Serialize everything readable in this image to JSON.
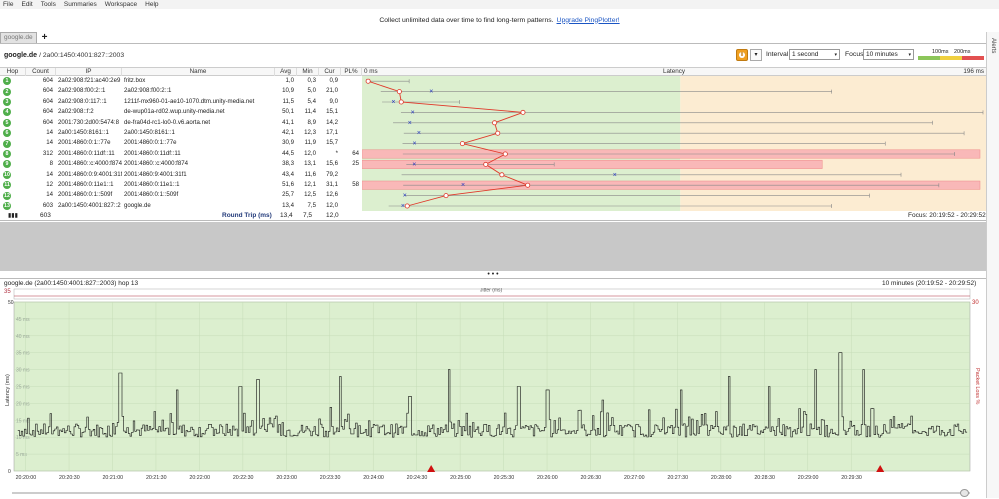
{
  "menu": [
    "File",
    "Edit",
    "Tools",
    "Summaries",
    "Workspace",
    "Help"
  ],
  "promo": {
    "text": "Collect unlimited data over time to find long-term patterns.",
    "link": "Upgrade PingPlotter!"
  },
  "tab": {
    "label": "google.de",
    "add": "+"
  },
  "alerts": "Alerts",
  "target": {
    "name": "google.de",
    "ip": "/ 2a00:1450:4001:827::2003"
  },
  "controls": {
    "interval_label": "Interval",
    "interval_value": "1 second",
    "focus_label": "Focus",
    "focus_value": "10 minutes",
    "scale_100": "100ms",
    "scale_200": "200ms",
    "pause_icon": "pause-icon"
  },
  "columns": {
    "hop": "Hop",
    "count": "Count",
    "ip": "IP",
    "name": "Name",
    "avg": "Avg",
    "min": "Min",
    "cur": "Cur",
    "pl": "PL%",
    "zero": "0 ms",
    "latency": "Latency",
    "max": "196 ms"
  },
  "hops": [
    {
      "hop": "1",
      "count": "604",
      "ip": "2a02:908:f21:ac40:2e9",
      "name": "fritz.box",
      "avg": "1,0",
      "min": "0,3",
      "cur": "0,9",
      "pl": "",
      "avgv": 1.0,
      "minv": 0.3,
      "curv": 0.9,
      "maxv": 14
    },
    {
      "hop": "2",
      "count": "604",
      "ip": "2a02:908:f00:2::1",
      "name": "2a02:908:f00:2::1",
      "avg": "10,9",
      "min": "5,0",
      "cur": "21,0",
      "pl": "",
      "avgv": 10.9,
      "minv": 5.0,
      "curv": 21.0,
      "maxv": 148
    },
    {
      "hop": "3",
      "count": "604",
      "ip": "2a02:908:0:117::1",
      "name": "1211f-mx960-01-ae10-1070.dtm.unity-media.net",
      "avg": "11,5",
      "min": "5,4",
      "cur": "9,0",
      "pl": "",
      "avgv": 11.5,
      "minv": 5.4,
      "curv": 9.0,
      "maxv": 30
    },
    {
      "hop": "4",
      "count": "604",
      "ip": "2a02:908::f:2",
      "name": "de-wup01a-rd02.wup.unity-media.net",
      "avg": "50,1",
      "min": "11,4",
      "cur": "15,1",
      "pl": "",
      "avgv": 50.1,
      "minv": 11.4,
      "curv": 15.1,
      "maxv": 196
    },
    {
      "hop": "5",
      "count": "604",
      "ip": "2001:730:2d00:5474:8",
      "name": "de-fra04d-rc1-lo0-0.v6.aorta.net",
      "avg": "41,1",
      "min": "8,9",
      "cur": "14,2",
      "pl": "",
      "avgv": 41.1,
      "minv": 8.9,
      "curv": 14.2,
      "maxv": 180
    },
    {
      "hop": "6",
      "count": "14",
      "ip": "2a00:1450:8161::1",
      "name": "2a00:1450:8161::1",
      "avg": "42,1",
      "min": "12,3",
      "cur": "17,1",
      "pl": "",
      "avgv": 42.1,
      "minv": 12.3,
      "curv": 17.1,
      "maxv": 190
    },
    {
      "hop": "7",
      "count": "14",
      "ip": "2001:4860:0:1::77e",
      "name": "2001:4860:0:1::77e",
      "avg": "30,9",
      "min": "11,9",
      "cur": "15,7",
      "pl": "",
      "avgv": 30.9,
      "minv": 11.9,
      "curv": 15.7,
      "maxv": 165
    },
    {
      "hop": "8",
      "count": "312",
      "ip": "2001:4860:0:11df::11",
      "name": "2001:4860:0:11df::11",
      "avg": "44,5",
      "min": "12,0",
      "cur": "*",
      "pl": "64",
      "avgv": 44.5,
      "minv": 12.0,
      "curv": null,
      "maxv": 187,
      "loss": 64
    },
    {
      "hop": "9",
      "count": "8",
      "ip": "2001:4860::c:4000:f874",
      "name": "2001:4860::c:4000:f874",
      "avg": "38,3",
      "min": "13,1",
      "cur": "15,6",
      "pl": "25",
      "avgv": 38.3,
      "minv": 13.1,
      "curv": 15.6,
      "maxv": 60,
      "loss": 25
    },
    {
      "hop": "10",
      "count": "14",
      "ip": "2001:4860:0:9:4001:31f1",
      "name": "2001:4860:9:4001:31f1",
      "avg": "43,4",
      "min": "11,6",
      "cur": "79,2",
      "pl": "",
      "avgv": 43.4,
      "minv": 11.6,
      "curv": 79.2,
      "maxv": 170
    },
    {
      "hop": "11",
      "count": "12",
      "ip": "2001:4860:0:11e1::1",
      "name": "2001:4860:0:11e1::1",
      "avg": "51,6",
      "min": "12,1",
      "cur": "31,1",
      "pl": "58",
      "avgv": 51.6,
      "minv": 12.1,
      "curv": 31.1,
      "maxv": 182,
      "loss": 58
    },
    {
      "hop": "12",
      "count": "14",
      "ip": "2001:4860:0:1::509f",
      "name": "2001:4860:0:1::509f",
      "avg": "25,7",
      "min": "12,5",
      "cur": "12,6",
      "pl": "",
      "avgv": 25.7,
      "minv": 12.5,
      "curv": 12.6,
      "maxv": 160
    },
    {
      "hop": "13",
      "count": "603",
      "ip": "2a00:1450:4001:827::2",
      "name": "google.de",
      "avg": "13,4",
      "min": "7,5",
      "cur": "12,0",
      "pl": "",
      "avgv": 13.4,
      "minv": 7.5,
      "curv": 12.0,
      "maxv": 148
    }
  ],
  "summary": {
    "count": "603",
    "label": "Round Trip (ms)",
    "avg": "13,4",
    "min": "7,5",
    "cur": "12,0",
    "focus": "Focus: 20:19:52 - 20:29:52"
  },
  "lower": {
    "title": "google.de (2a00:1450:4001:827::2003) hop 13",
    "range": "10 minutes (20:19:52 - 20:29:52)",
    "jitter": "Jitter (ms)",
    "jitter_max": "35",
    "pl_max": "30",
    "ylabel": "Latency (ms)",
    "y2label": "Packet Loss %"
  },
  "chart_data": {
    "type": "line",
    "title": "google.de (2a00:1450:4001:827::2003) hop 13",
    "ylabel": "Latency (ms)",
    "y2label": "Packet Loss %",
    "ylim": [
      0,
      50
    ],
    "y_ticks": [
      "50",
      "45 ms",
      "40 ms",
      "35 ms",
      "30 ms",
      "25 ms",
      "20 ms",
      "15 ms",
      "10 ms",
      "5 ms",
      "0"
    ],
    "x_ticks": [
      "20:20:00",
      "20:20:30",
      "20:21:00",
      "20:21:30",
      "20:22:00",
      "20:22:30",
      "20:23:00",
      "20:23:30",
      "20:24:00",
      "20:24:30",
      "20:25:00",
      "20:25:30",
      "20:26:00",
      "20:26:30",
      "20:27:00",
      "20:27:30",
      "20:28:00",
      "20:28:30",
      "20:29:00",
      "20:29:30"
    ],
    "loss_markers": [
      "20:24:40",
      "20:29:50"
    ],
    "spikes": [
      {
        "t": "20:21:05",
        "v": 29
      },
      {
        "t": "20:21:44",
        "v": 24
      },
      {
        "t": "20:22:28",
        "v": 25
      },
      {
        "t": "20:22:40",
        "v": 27
      },
      {
        "t": "20:23:37",
        "v": 28
      },
      {
        "t": "20:24:25",
        "v": 22
      },
      {
        "t": "20:24:52",
        "v": 30
      },
      {
        "t": "20:25:40",
        "v": 25
      },
      {
        "t": "20:26:00",
        "v": 24
      },
      {
        "t": "20:26:38",
        "v": 21
      },
      {
        "t": "20:27:32",
        "v": 24
      },
      {
        "t": "20:28:05",
        "v": 28
      },
      {
        "t": "20:28:33",
        "v": 25
      },
      {
        "t": "20:29:05",
        "v": 30
      },
      {
        "t": "20:29:22",
        "v": 35
      },
      {
        "t": "20:29:38",
        "v": 30
      }
    ],
    "baseline": 12
  }
}
